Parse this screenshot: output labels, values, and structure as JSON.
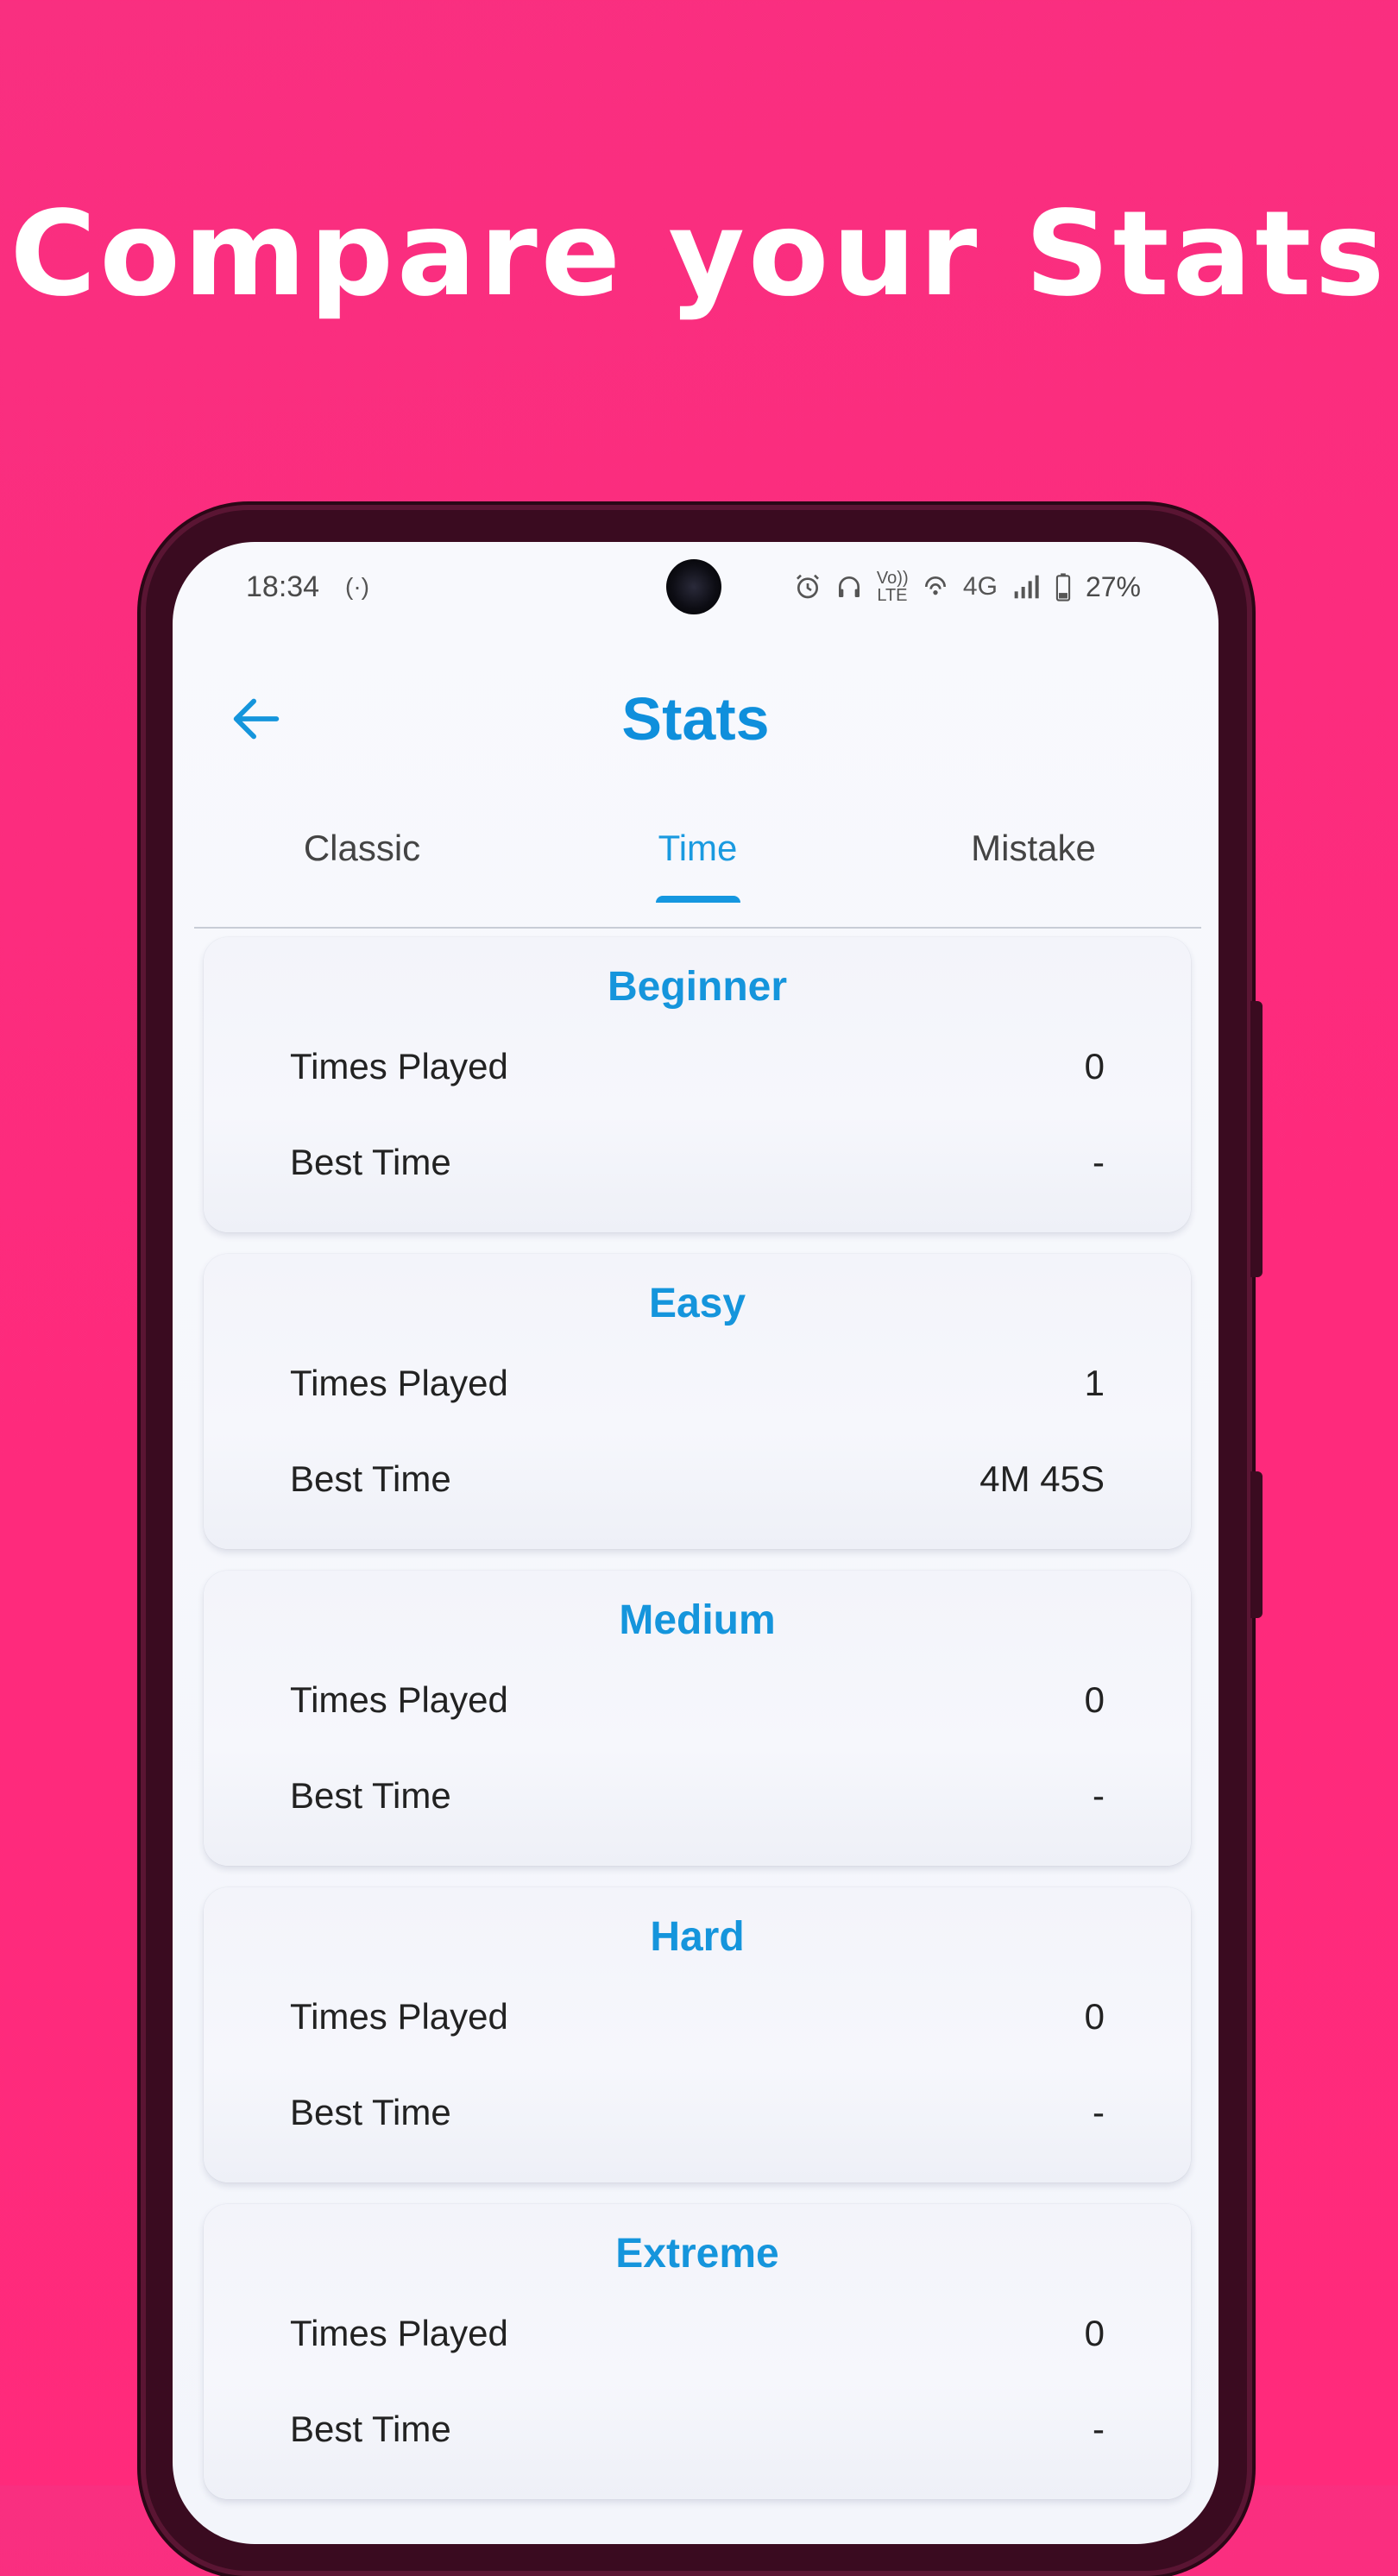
{
  "headline": "Compare your Stats",
  "status_bar": {
    "time": "18:34",
    "hotspot_glyph": "(·)",
    "volte_label": "Vo)) LTE",
    "network": "4G",
    "battery": "27%"
  },
  "header": {
    "title": "Stats"
  },
  "tabs": [
    {
      "label": "Classic",
      "active": false
    },
    {
      "label": "Time",
      "active": true
    },
    {
      "label": "Mistake",
      "active": false
    }
  ],
  "cards": [
    {
      "title": "Beginner",
      "times_played_label": "Times Played",
      "times_played": "0",
      "best_time_label": "Best Time",
      "best_time": "-"
    },
    {
      "title": "Easy",
      "times_played_label": "Times Played",
      "times_played": "1",
      "best_time_label": "Best Time",
      "best_time": "4M 45S"
    },
    {
      "title": "Medium",
      "times_played_label": "Times Played",
      "times_played": "0",
      "best_time_label": "Best Time",
      "best_time": "-"
    },
    {
      "title": "Hard",
      "times_played_label": "Times Played",
      "times_played": "0",
      "best_time_label": "Best Time",
      "best_time": "-"
    },
    {
      "title": "Extreme",
      "times_played_label": "Times Played",
      "times_played": "0",
      "best_time_label": "Best Time",
      "best_time": "-"
    }
  ],
  "colors": {
    "background": "#fe2a7c",
    "accent": "#1595dc",
    "phone_frame": "#3a0b20"
  }
}
